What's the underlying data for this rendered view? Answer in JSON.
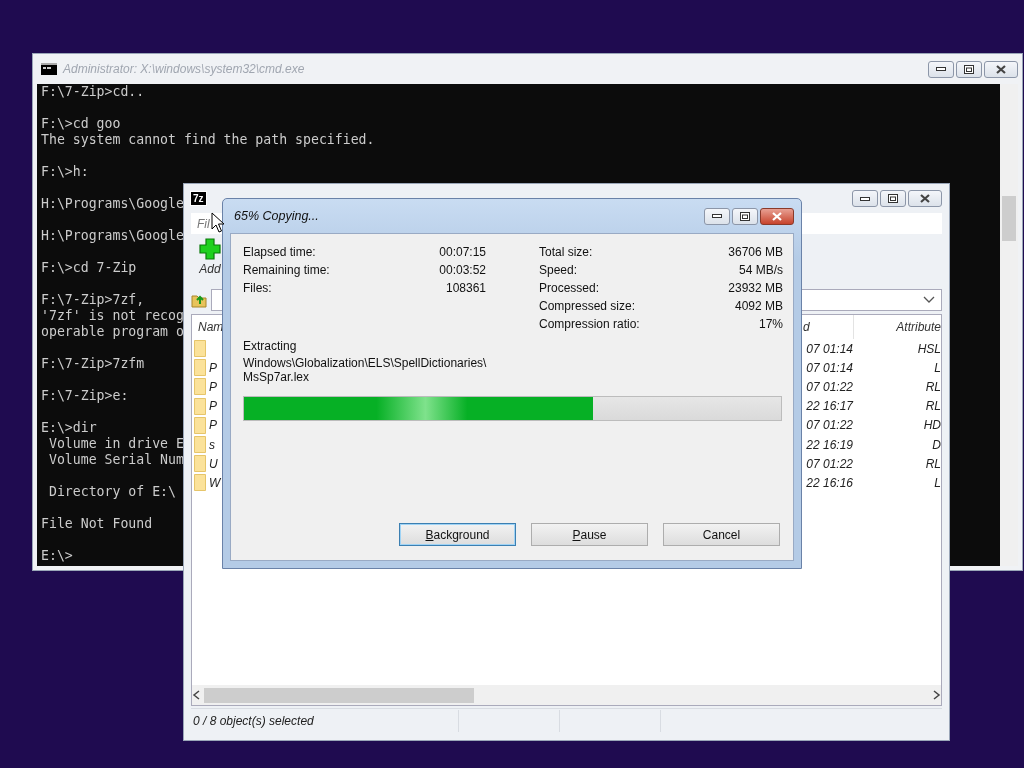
{
  "cmd_window": {
    "title": "Administrator: X:\\windows\\system32\\cmd.exe",
    "active": false,
    "blocks": [
      [
        "F:\\7-Zip>cd.."
      ],
      [
        "F:\\>cd goo",
        "The system cannot find the path specified."
      ],
      [
        "F:\\>h:"
      ],
      [
        "H:\\Programs\\Google"
      ],
      [
        "H:\\Programs\\Google"
      ],
      [
        "F:\\>cd 7-Zip"
      ],
      [
        "F:\\7-Zip>7zf,",
        "'7zf' is not recog",
        "operable program o"
      ],
      [
        "F:\\7-Zip>7zfm"
      ],
      [
        "F:\\7-Zip>e:"
      ],
      [
        "E:\\>dir",
        " Volume in drive E",
        " Volume Serial Num"
      ],
      [
        " Directory of E:\\"
      ],
      [
        "File Not Found"
      ],
      [
        "E:\\>"
      ]
    ]
  },
  "zip_window": {
    "logo_text": "7z",
    "active": false,
    "menu": [
      {
        "label": "Fil"
      }
    ],
    "toolbar": [
      {
        "label": "Add"
      }
    ],
    "columns": [
      "Nam",
      "d",
      "Attribute"
    ],
    "rows": [
      {
        "modified": "07 01:14",
        "attributes": "HSL"
      },
      {
        "name": "P",
        "modified": "07 01:14",
        "attributes": "L"
      },
      {
        "name": "P",
        "modified": "07 01:22",
        "attributes": "RL"
      },
      {
        "name": "P",
        "modified": "22 16:17",
        "attributes": "RL"
      },
      {
        "name": "P",
        "modified": "07 01:22",
        "attributes": "HD"
      },
      {
        "name": "s",
        "modified": "22 16:19",
        "attributes": "D"
      },
      {
        "name": "U",
        "modified": "07 01:22",
        "attributes": "RL"
      },
      {
        "name": "W",
        "modified": "22 16:16",
        "attributes": "L"
      }
    ],
    "status": "0 / 8 object(s) selected"
  },
  "progress_dialog": {
    "title": "65% Copying...",
    "active": true,
    "stats_left": [
      {
        "label": "Elapsed time:",
        "value": "00:07:15"
      },
      {
        "label": "Remaining time:",
        "value": "00:03:52"
      },
      {
        "label": "Files:",
        "value": "108361"
      }
    ],
    "stats_right": [
      {
        "label": "Total size:",
        "value": "36706 MB"
      },
      {
        "label": "Speed:",
        "value": "54 MB/s"
      },
      {
        "label": "Processed:",
        "value": "23932 MB"
      },
      {
        "label": "Compressed size:",
        "value": "4092 MB"
      },
      {
        "label": "Compression ratio:",
        "value": "17%"
      }
    ],
    "operation": "Extracting",
    "path_lines": [
      "Windows\\Globalization\\ELS\\SpellDictionaries\\",
      "MsSp7ar.lex"
    ],
    "level": 0.65,
    "buttons": [
      {
        "label": "Background",
        "first_letter_underlined": true,
        "focused": true
      },
      {
        "label": "Pause",
        "first_letter_underlined": true,
        "focused": false
      },
      {
        "label": "Cancel",
        "first_letter_underlined": false,
        "focused": false
      }
    ]
  }
}
